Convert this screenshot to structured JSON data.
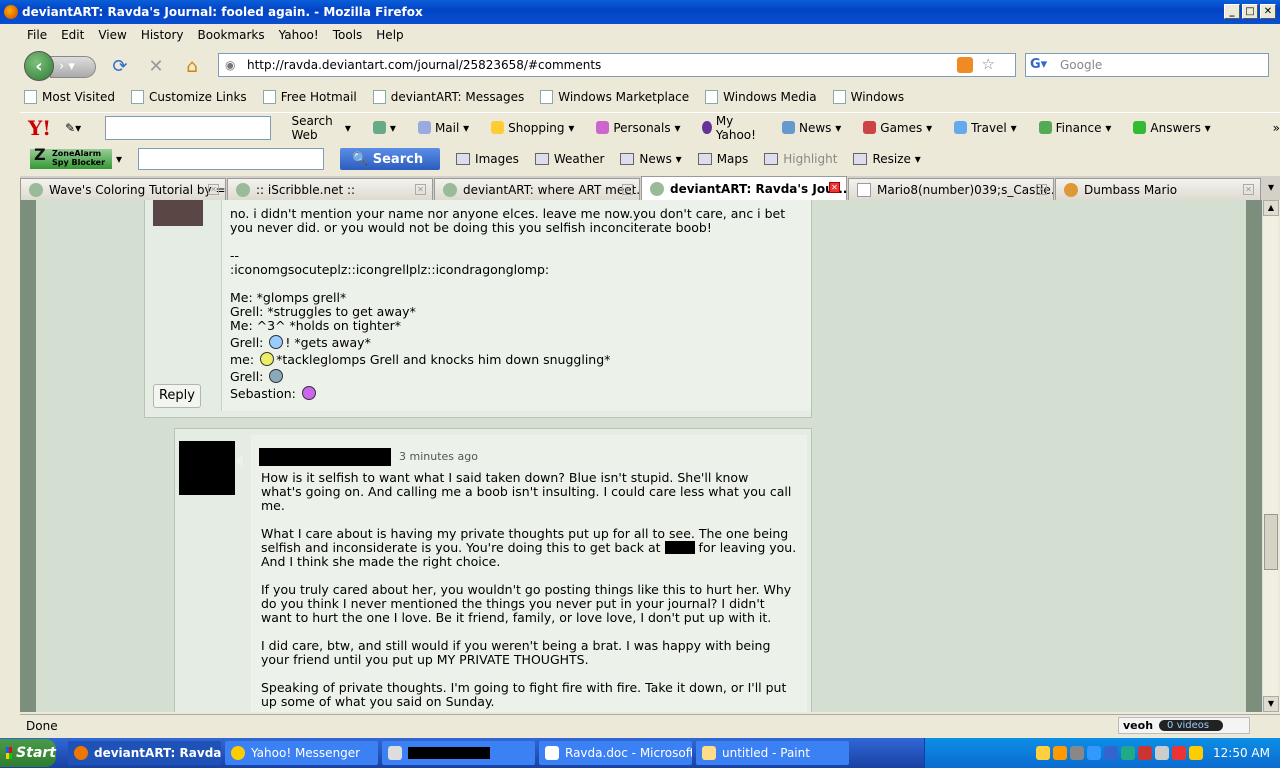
{
  "window": {
    "title": "deviantART: Ravda's Journal: fooled again. - Mozilla Firefox"
  },
  "menu": [
    "File",
    "Edit",
    "View",
    "History",
    "Bookmarks",
    "Yahoo!",
    "Tools",
    "Help"
  ],
  "nav": {
    "url": "http://ravda.deviantart.com/journal/25823658/#comments",
    "search_placeholder": "Google"
  },
  "bookmarks": [
    "Most Visited",
    "Customize Links",
    "Free Hotmail",
    "deviantART: Messages",
    "Windows Marketplace",
    "Windows Media",
    "Windows"
  ],
  "yahoo_toolbar": {
    "logo": "Y!",
    "items": [
      "Search Web",
      "Mail",
      "Shopping",
      "Personals",
      "My Yahoo!",
      "News",
      "Games",
      "Travel",
      "Finance",
      "Answers"
    ],
    "more": "»"
  },
  "za_toolbar": {
    "logo": "ZoneAlarm Spy Blocker",
    "search": "Search",
    "items": [
      "Images",
      "Weather",
      "News",
      "Maps",
      "Highlight",
      "Resize"
    ]
  },
  "tabs": [
    "Wave's Coloring Tutorial by =...",
    ":: iScribble.net ::",
    "deviantART: where ART meet...",
    "deviantART: Ravda's Jou...",
    "Mario8(number)039;s_Castle...",
    "Dumbass Mario"
  ],
  "comment1": {
    "lines": [
      "no. i didn't mention your name nor anyone elces. leave me now.you don't care, anc i bet",
      "you never did. or you would not be doing this you selfish inconciterate boob!"
    ],
    "sig1": "--",
    "sig2": ":iconomgsocuteplz::icongrellplz::icondragonglomp:",
    "rp": [
      "Me: *glomps grell*",
      "Grell: *struggles to get away*",
      "Me: ^3^ *holds on tighter*"
    ],
    "rp_g1a": "Grell:",
    "rp_g1b": "! *gets away*",
    "rp_me": "me:",
    "rp_me2": "*tackleglomps Grell and knocks him down snuggling*",
    "rp_g2": "Grell:",
    "rp_seb": "Sebastion:",
    "reply": "Reply"
  },
  "comment2": {
    "time": "3 minutes ago",
    "p1": [
      "How is it selfish to want what I said taken down? Blue isn't stupid. She'll know",
      "what's going on. And calling me a boob isn't insulting. I could care less what you call",
      "me."
    ],
    "p2a": [
      "What I care about is having my private thoughts put up for all to see. The one being"
    ],
    "p2b": "selfish and inconsiderate is you. You're doing this to get back at",
    "p2c": "for leaving you.",
    "p2d": "And I think she made the right choice.",
    "p3": [
      "If you truly cared about her, you wouldn't go posting things like this to hurt her. Why",
      "do you think I never mentioned the things you never put in your journal? I didn't",
      "want to hurt the one I love. Be it friend, family, or love love, I don't put up with it."
    ],
    "p4": [
      "I did care, btw, and still would if you weren't being a brat. I was happy with being",
      "your friend until you put up MY PRIVATE THOUGHTS."
    ],
    "p5": [
      "Speaking of private thoughts. I'm going to fight fire with fire. Take it down, or I'll put",
      "up some of what you said on Sunday."
    ]
  },
  "status": {
    "text": "Done",
    "veoh": "veoh",
    "videos": "0 videos"
  },
  "taskbar": {
    "start": "Start",
    "tasks": [
      "deviantART: Ravda's...",
      "Yahoo! Messenger",
      "",
      "Ravda.doc - Microsoft ...",
      "untitled - Paint"
    ],
    "time": "12:50 AM"
  }
}
